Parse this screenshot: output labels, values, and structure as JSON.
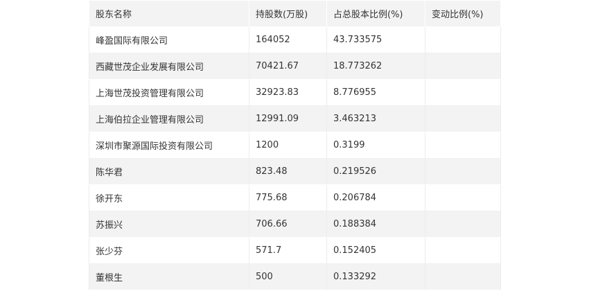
{
  "table": {
    "headers": [
      "股东名称",
      "持股数(万股)",
      "占总股本比例(%)",
      "变动比例(%)"
    ],
    "rows": [
      {
        "name": "峰盈国际有限公司",
        "shares": "164052",
        "ratio": "43.733575",
        "change": ""
      },
      {
        "name": "西藏世茂企业发展有限公司",
        "shares": "70421.67",
        "ratio": "18.773262",
        "change": ""
      },
      {
        "name": "上海世茂投资管理有限公司",
        "shares": "32923.83",
        "ratio": "8.776955",
        "change": ""
      },
      {
        "name": "上海伯拉企业管理有限公司",
        "shares": "12991.09",
        "ratio": "3.463213",
        "change": ""
      },
      {
        "name": "深圳市聚源国际投资有限公司",
        "shares": "1200",
        "ratio": "0.3199",
        "change": ""
      },
      {
        "name": "陈华君",
        "shares": "823.48",
        "ratio": "0.219526",
        "change": ""
      },
      {
        "name": "徐开东",
        "shares": "775.68",
        "ratio": "0.206784",
        "change": ""
      },
      {
        "name": "苏振兴",
        "shares": "706.66",
        "ratio": "0.188384",
        "change": ""
      },
      {
        "name": "张少芬",
        "shares": "571.7",
        "ratio": "0.152405",
        "change": ""
      },
      {
        "name": "董根生",
        "shares": "500",
        "ratio": "0.133292",
        "change": ""
      }
    ]
  }
}
